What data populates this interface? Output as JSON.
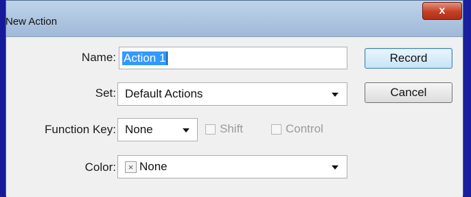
{
  "window": {
    "title": "New Action",
    "close_symbol": "x"
  },
  "form": {
    "name_label": "Name:",
    "name_value": "Action 1",
    "set_label": "Set:",
    "set_value": "Default Actions",
    "function_key_label": "Function Key:",
    "function_key_value": "None",
    "shift_label": "Shift",
    "control_label": "Control",
    "color_label": "Color:",
    "color_value": "None",
    "color_swatch_symbol": "×"
  },
  "buttons": {
    "record": "Record",
    "cancel": "Cancel"
  },
  "colors": {
    "desktop": "#1a1f8c",
    "titlebar": "#bdd0e6",
    "content": "#f0f0f0",
    "selection": "#3399ff",
    "close_button": "#c43f24"
  },
  "icons": {
    "close": "close-icon",
    "dropdown": "chevron-down-icon",
    "color_swatch": "x-swatch-icon"
  }
}
